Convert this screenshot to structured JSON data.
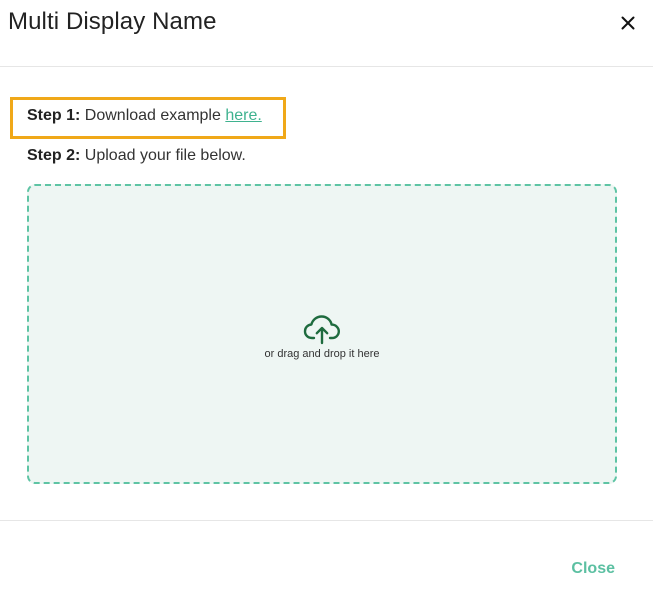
{
  "dialog": {
    "title": "Multi Display Name",
    "close_icon": "close-icon"
  },
  "steps": {
    "step1": {
      "label": "Step 1:",
      "text": "Download example",
      "link_text": "here."
    },
    "step2": {
      "label": "Step 2:",
      "text": "Upload your file below."
    }
  },
  "dropzone": {
    "icon": "cloud-upload-icon",
    "text": "or drag and drop it here"
  },
  "footer": {
    "close_label": "Close"
  },
  "colors": {
    "accent": "#3fb28f",
    "highlight": "#f0a818",
    "dropzone_bg": "#eef6f3",
    "dropzone_border": "#5ec4a4",
    "icon": "#1e6b3e"
  }
}
